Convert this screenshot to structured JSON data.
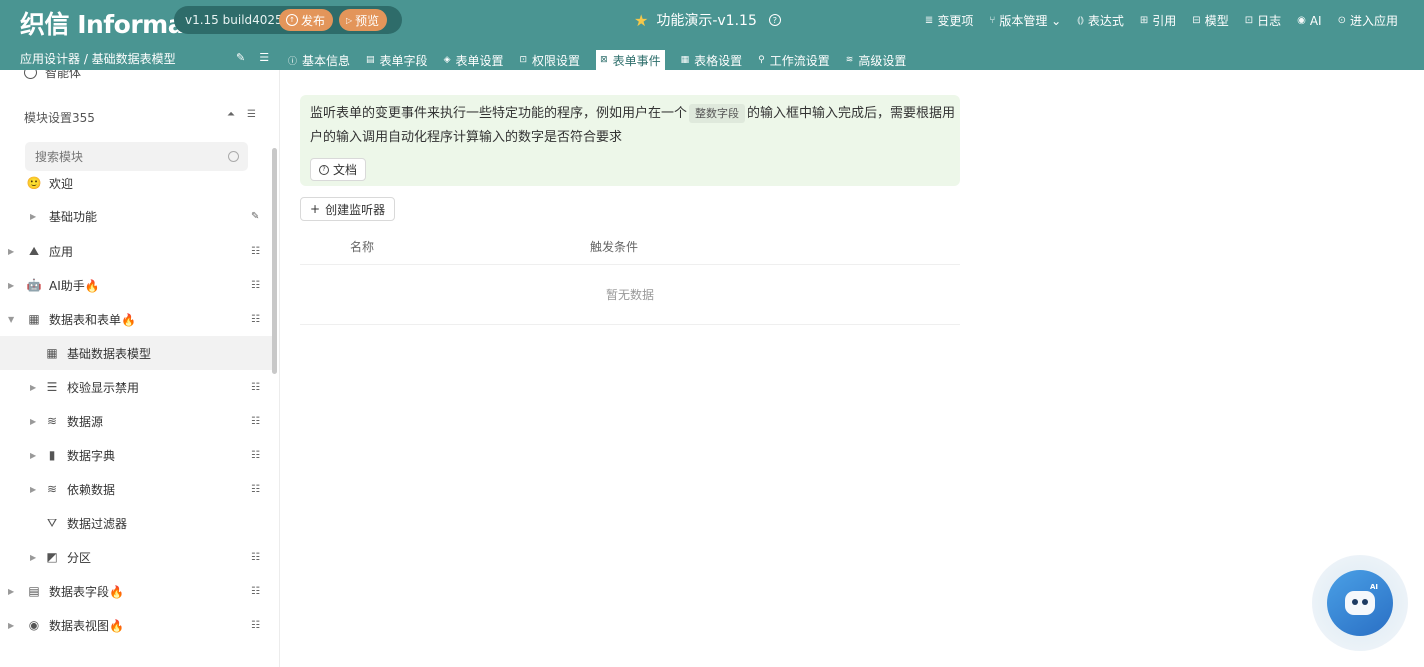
{
  "header": {
    "logo": "织信 Informat",
    "version": "v1.15 build4025",
    "publish_label": "发布",
    "preview_label": "预览",
    "app_title": "功能演示-v1.15",
    "nav": [
      {
        "icon": "≣",
        "label": "变更项"
      },
      {
        "icon": "⑂",
        "label": "版本管理 ⌄"
      },
      {
        "icon": "⦅⦆",
        "label": "表达式"
      },
      {
        "icon": "⊞",
        "label": "引用"
      },
      {
        "icon": "⊟",
        "label": "模型"
      },
      {
        "icon": "⊡",
        "label": "日志"
      },
      {
        "icon": "◉",
        "label": "AI"
      },
      {
        "icon": "⊙",
        "label": "进入应用"
      }
    ],
    "breadcrumb": "应用设计器 / 基础数据表模型",
    "tabs": [
      {
        "icon": "ⓘ",
        "label": "基本信息"
      },
      {
        "icon": "▤",
        "label": "表单字段"
      },
      {
        "icon": "◈",
        "label": "表单设置"
      },
      {
        "icon": "⊡",
        "label": "权限设置"
      },
      {
        "icon": "⊠",
        "label": "表单事件"
      },
      {
        "icon": "▦",
        "label": "表格设置"
      },
      {
        "icon": "⚲",
        "label": "工作流设置"
      },
      {
        "icon": "≋",
        "label": "高级设置"
      }
    ],
    "active_tab_index": 4
  },
  "sidebar": {
    "agent_label": "智能体",
    "module_head": "模块设置355",
    "search_placeholder": "搜索模块",
    "items": [
      {
        "label": "欢迎",
        "icon": "🙂"
      },
      {
        "label": "基础功能",
        "icon": ""
      },
      {
        "label": "应用",
        "icon": "⛰"
      },
      {
        "label": "AI助手🔥",
        "icon": "🤖"
      },
      {
        "label": "数据表和表单🔥",
        "icon": "▦"
      },
      {
        "label": "基础数据表模型",
        "icon": "▦"
      },
      {
        "label": "校验显示禁用",
        "icon": "☰"
      },
      {
        "label": "数据源",
        "icon": "≋"
      },
      {
        "label": "数据字典",
        "icon": "▮"
      },
      {
        "label": "依赖数据",
        "icon": "≋"
      },
      {
        "label": "数据过滤器",
        "icon": "⛛"
      },
      {
        "label": "分区",
        "icon": "◩"
      },
      {
        "label": "数据表字段🔥",
        "icon": "▤"
      },
      {
        "label": "数据表视图🔥",
        "icon": "◉"
      }
    ]
  },
  "main": {
    "notice_before": "监听表单的变更事件来执行一些特定功能的程序，例如用户在一个",
    "notice_chip": "整数字段",
    "notice_after": "的输入框中输入完成后，需要根据用户的输入调用自动化程序计算输入的数字是否符合要求",
    "doc_label": "文档",
    "create_label": "创建监听器",
    "col_name": "名称",
    "col_trigger": "触发条件",
    "empty_text": "暂无数据"
  },
  "colors": {
    "header_bg": "#4a9592",
    "accent_orange": "#e3955a",
    "notice_bg": "#edf7e9"
  }
}
